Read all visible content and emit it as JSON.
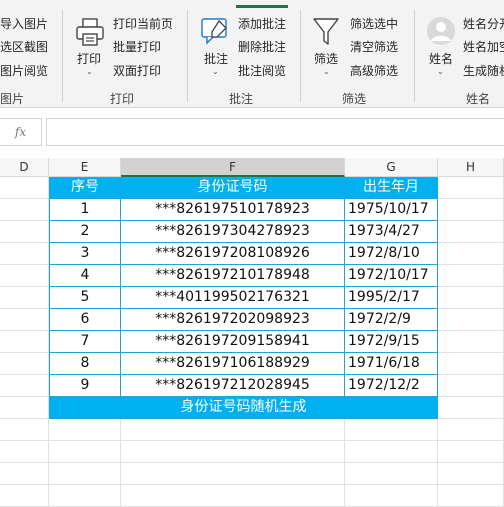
{
  "ribbon": {
    "image_group": {
      "items": [
        "导入图片",
        "选区截图",
        "图片阅览"
      ],
      "label": "图片"
    },
    "print_group": {
      "big_button": "打印",
      "items": [
        "打印当前页",
        "批量打印",
        "双面打印"
      ],
      "label": "打印"
    },
    "comment_group": {
      "big_button": "批注",
      "items": [
        "添加批注",
        "删除批注",
        "批注阅览"
      ],
      "label": "批注"
    },
    "filter_group": {
      "big_button": "筛选",
      "items": [
        "筛选选中",
        "清空筛选",
        "高级筛选"
      ],
      "label": "筛选"
    },
    "name_group": {
      "big_button": "姓名",
      "items": [
        "姓名分开",
        "姓名加空",
        "生成随机"
      ],
      "label": "姓名"
    }
  },
  "formula_bar": {
    "fx_label": "fx",
    "value": ""
  },
  "columns": [
    "D",
    "E",
    "F",
    "G",
    "H"
  ],
  "selected_column": "F",
  "table": {
    "headers": [
      "序号",
      "身份证号码",
      "出生年月"
    ],
    "rows": [
      {
        "no": "1",
        "id": "***826197510178923",
        "birth": "1975/10/17"
      },
      {
        "no": "2",
        "id": "***826197304278923",
        "birth": "1973/4/27"
      },
      {
        "no": "3",
        "id": "***826197208108926",
        "birth": "1972/8/10"
      },
      {
        "no": "4",
        "id": "***826197210178948",
        "birth": "1972/10/17"
      },
      {
        "no": "5",
        "id": "***401199502176321",
        "birth": "1995/2/17"
      },
      {
        "no": "6",
        "id": "***826197202098923",
        "birth": "1972/2/9"
      },
      {
        "no": "7",
        "id": "***826197209158941",
        "birth": "1972/9/15"
      },
      {
        "no": "8",
        "id": "***826197106188929",
        "birth": "1971/6/18"
      },
      {
        "no": "9",
        "id": "***826197212028945",
        "birth": "1972/12/2"
      }
    ],
    "footer": "身份证号码随机生成"
  },
  "colors": {
    "header_fill": "#00b0f0",
    "table_border": "#1fa3d8",
    "selection_green": "#217346"
  }
}
